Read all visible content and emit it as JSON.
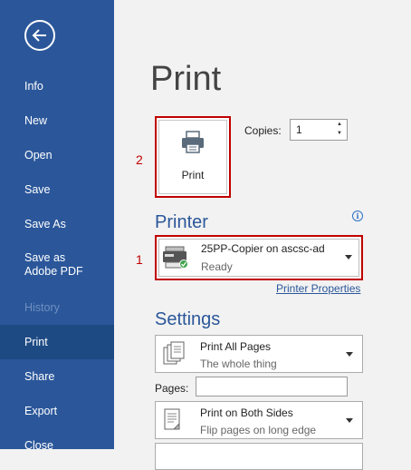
{
  "sidebar": {
    "items": [
      {
        "label": "Info"
      },
      {
        "label": "New"
      },
      {
        "label": "Open"
      },
      {
        "label": "Save"
      },
      {
        "label": "Save As"
      },
      {
        "label": "Save as Adobe PDF"
      },
      {
        "label": "History"
      },
      {
        "label": "Print"
      },
      {
        "label": "Share"
      },
      {
        "label": "Export"
      },
      {
        "label": "Close"
      }
    ]
  },
  "main": {
    "title": "Print",
    "print_button_label": "Print",
    "copies_label": "Copies:",
    "copies_value": "1",
    "callout_1": "1",
    "callout_2": "2",
    "printer_heading": "Printer",
    "printer_name": "25PP-Copier on ascsc-ad",
    "printer_status": "Ready",
    "printer_properties": "Printer Properties",
    "settings_heading": "Settings",
    "pages_setting": {
      "title": "Print All Pages",
      "subtitle": "The whole thing"
    },
    "pages_label": "Pages:",
    "pages_value": "",
    "sides_setting": {
      "title": "Print on Both Sides",
      "subtitle": "Flip pages on long edge"
    }
  },
  "colors": {
    "sidebar": "#2b579a",
    "active": "#1e4a84",
    "accent": "#2b579a",
    "callout": "#c00000"
  }
}
